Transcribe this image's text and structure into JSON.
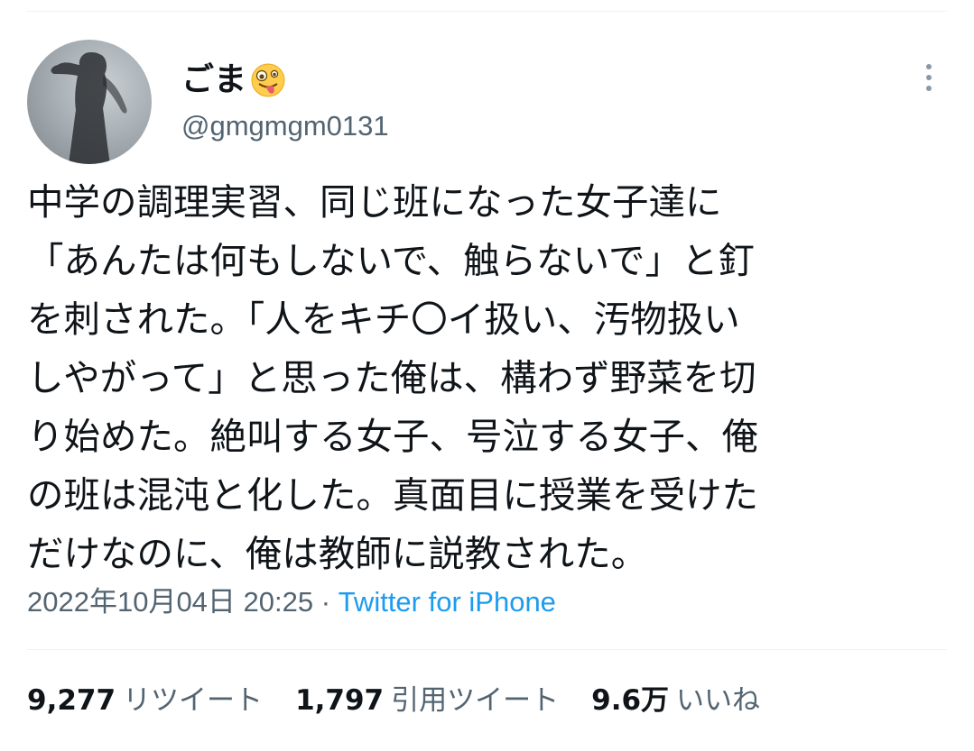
{
  "author": {
    "display_name": "ごま",
    "emoji_icon": "zany-face-emoji",
    "handle": "@gmgmgm0131"
  },
  "tweet": {
    "lines": [
      "中学の調理実習、同じ班になった女子達に",
      "「あんたは何もしないで、触らないで」と釘",
      "を刺された。「人をキチ〇イ扱い、汚物扱い",
      "しやがって」と思った俺は、構わず野菜を切",
      "り始めた。絶叫する女子、号泣する女子、俺",
      "の班は混沌と化した。真面目に授業を受けた",
      "だけなのに、俺は教師に説教された。"
    ]
  },
  "meta": {
    "timestamp": "2022年10月04日 20:25",
    "separator": "·",
    "source": "Twitter for iPhone"
  },
  "stats": {
    "retweets": {
      "count": "9,277",
      "label": "リツイート"
    },
    "quotes": {
      "count": "1,797",
      "label": "引用ツイート"
    },
    "likes": {
      "count": "9.6万",
      "label": "いいね"
    }
  },
  "colors": {
    "text": "#0f1419",
    "secondary": "#536471",
    "link": "#1d9bf0",
    "divider": "#eff3f4"
  }
}
